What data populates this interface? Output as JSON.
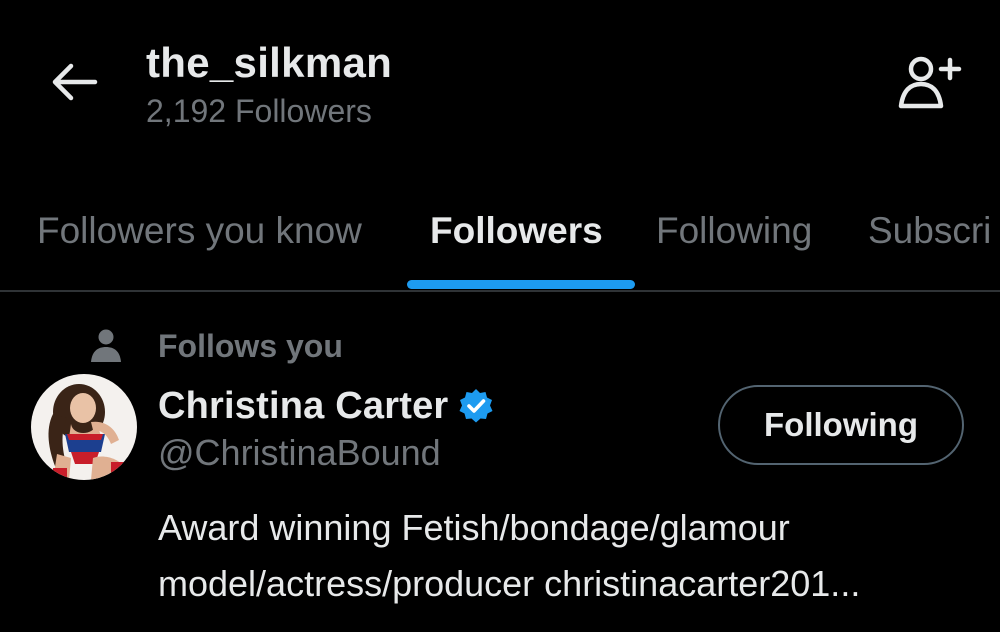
{
  "header": {
    "back_icon": "arrow-left-icon",
    "title": "the_silkman",
    "subtitle": "2,192 Followers",
    "add_user_icon": "add-user-icon"
  },
  "tabs": [
    {
      "label": "Followers you know",
      "active": false
    },
    {
      "label": "Followers",
      "active": true
    },
    {
      "label": "Following",
      "active": false
    },
    {
      "label": "Subscri",
      "active": false
    }
  ],
  "user": {
    "context_icon": "person-icon",
    "context_label": "Follows you",
    "name": "Christina Carter",
    "verified_icon": "verified-badge-icon",
    "handle": "@ChristinaBound",
    "button_label": "Following",
    "bio_line_1": "Award winning Fetish/bondage/glamour",
    "bio_line_2": "model/actress/producer christinacarter201..."
  },
  "colors": {
    "background": "#000000",
    "text_primary": "#e7e9ea",
    "text_secondary": "#71767b",
    "accent": "#1d9bf0",
    "divider": "#2f3336"
  }
}
